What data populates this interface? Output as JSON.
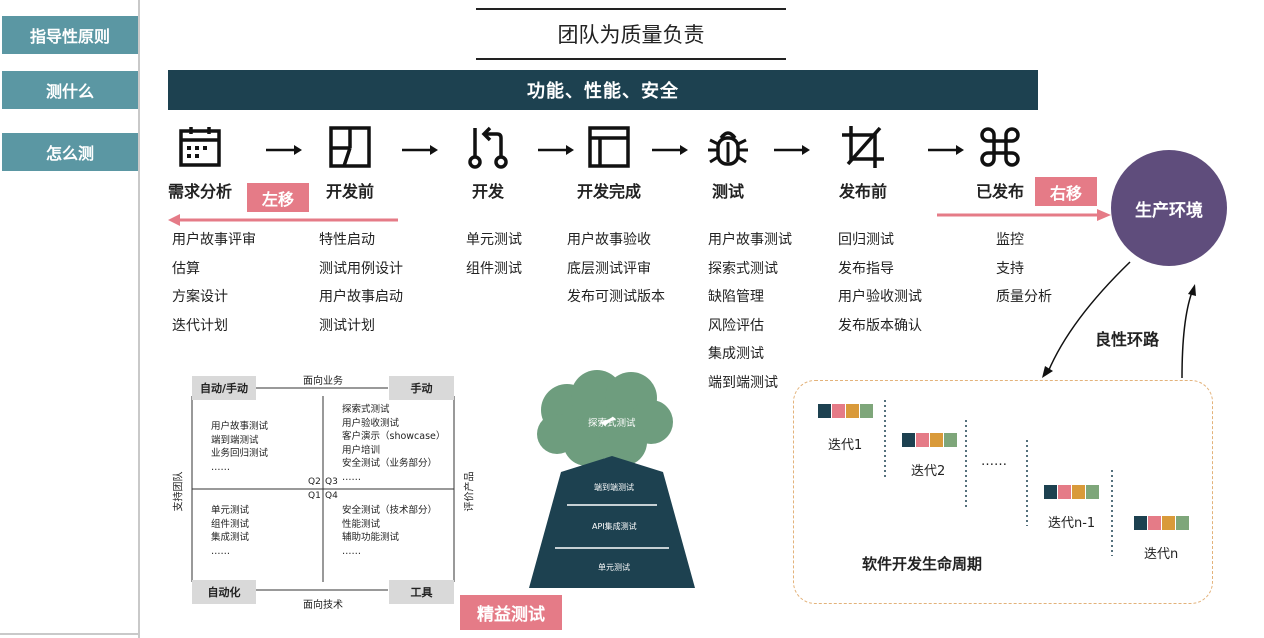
{
  "sidebar": {
    "items": [
      {
        "label": "指导性原则"
      },
      {
        "label": "测什么"
      },
      {
        "label": "怎么测"
      }
    ]
  },
  "title": "团队为质量负责",
  "banner": "功能、性能、安全",
  "stages": [
    {
      "label": "需求分析",
      "icon": "calendar-icon",
      "items": [
        "用户故事评审",
        "估算",
        "方案设计",
        "迭代计划"
      ]
    },
    {
      "label": "开发前",
      "icon": "layout-icon",
      "items": [
        "特性启动",
        "测试用例设计",
        "用户故事启动",
        "测试计划"
      ]
    },
    {
      "label": "开发",
      "icon": "git-pull-request-icon",
      "items": [
        "单元测试",
        "组件测试"
      ]
    },
    {
      "label": "开发完成",
      "icon": "browser-window-icon",
      "items": [
        "用户故事验收",
        "底层测试评审",
        "发布可测试版本"
      ]
    },
    {
      "label": "测试",
      "icon": "bug-icon",
      "items": [
        "用户故事测试",
        "探索式测试",
        "缺陷管理",
        "风险评估",
        "集成测试",
        "端到端测试"
      ]
    },
    {
      "label": "发布前",
      "icon": "crop-icon",
      "items": [
        "回归测试",
        "发布指导",
        "用户验收测试",
        "发布版本确认"
      ]
    },
    {
      "label": "已发布",
      "icon": "command-icon",
      "items": [
        "监控",
        "支持",
        "质量分析"
      ]
    }
  ],
  "shift_left": "左移",
  "shift_right": "右移",
  "production": "生产环境",
  "feedback_loop": "良性环路",
  "quadrants": {
    "top_left_box": "自动/手动",
    "top_right_box": "手动",
    "bottom_left_box": "自动化",
    "bottom_right_box": "工具",
    "top_axis": "面向业务",
    "bottom_axis": "面向技术",
    "left_axis": "支持团队",
    "right_axis": "评价产品",
    "q1": "Q1",
    "q2": "Q2",
    "q3": "Q3",
    "q4": "Q4",
    "q2_items": [
      "用户故事测试",
      "端到端测试",
      "业务回归测试",
      "……"
    ],
    "q3_items": [
      "探索式测试",
      "用户验收测试",
      "客户演示（showcase）",
      "用户培训",
      "安全测试（业务部分）",
      "……"
    ],
    "q1_items": [
      "单元测试",
      "组件测试",
      "集成测试",
      "……"
    ],
    "q4_items": [
      "安全测试（技术部分）",
      "性能测试",
      "辅助功能测试",
      "……"
    ]
  },
  "pyramid": {
    "cloud": "探索式测试",
    "levels": [
      "端到端测试",
      "API集成测试",
      "单元测试"
    ]
  },
  "lean_testing": "精益测试",
  "lifecycle": {
    "title": "软件开发生命周期",
    "iterations": [
      "迭代1",
      "迭代2",
      "……",
      "迭代n-1",
      "迭代n"
    ],
    "block_colors": [
      "#1d4150",
      "#e57b87",
      "#d99a3a",
      "#7ea67a"
    ]
  },
  "colors": {
    "sidebar": "#5b97a3",
    "banner": "#1d4150",
    "pink": "#e57b87",
    "production": "#5f4d7c",
    "pyramid": "#1d4150",
    "cloud": "#6e9d7e",
    "lifecycle_border": "#e3b27a"
  }
}
